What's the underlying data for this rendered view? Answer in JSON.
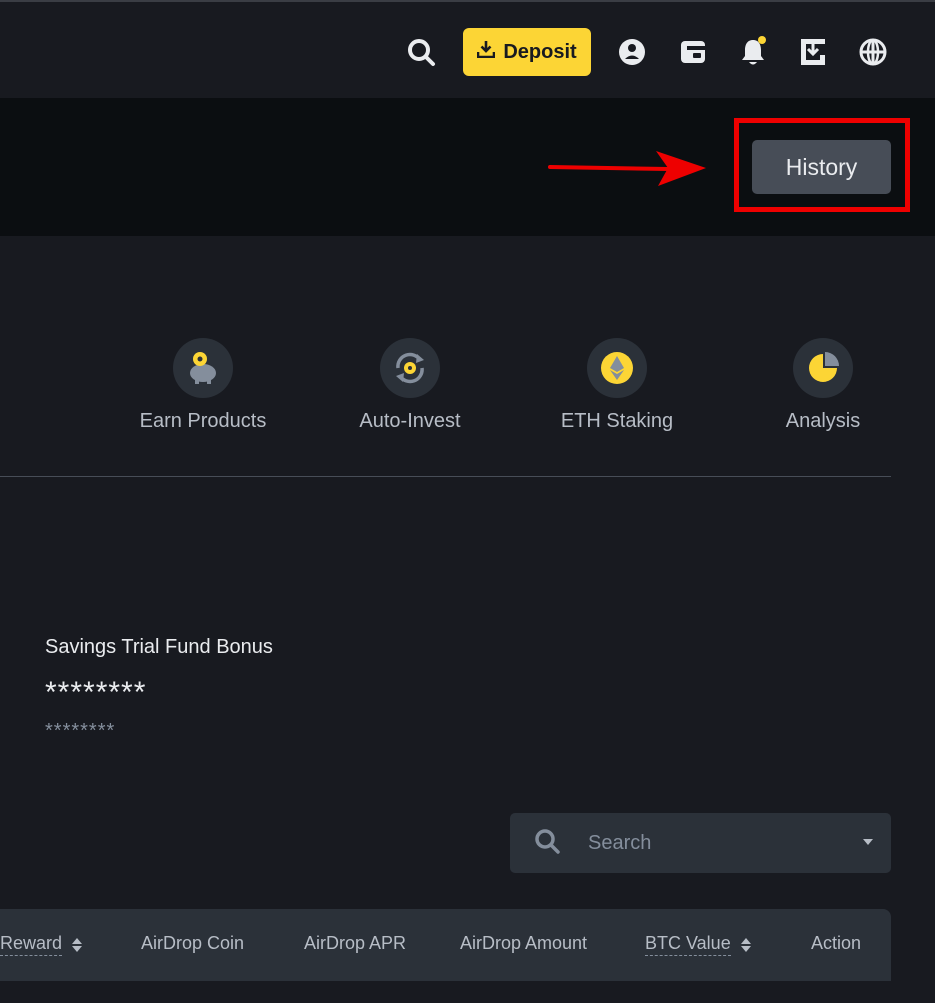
{
  "header": {
    "deposit_label": "Deposit",
    "icons": [
      "search-icon",
      "download-icon",
      "user-icon",
      "wallet-icon",
      "bell-icon",
      "app-download-icon",
      "globe-icon"
    ],
    "accent": "#fcd535"
  },
  "history": {
    "label": "History",
    "highlight_color": "#ee0000"
  },
  "nav": {
    "items": [
      {
        "label": "Earn Products",
        "icon": "piggy-bank-icon"
      },
      {
        "label": "Auto-Invest",
        "icon": "auto-invest-icon"
      },
      {
        "label": "ETH Staking",
        "icon": "ethereum-icon"
      },
      {
        "label": "Analysis",
        "icon": "pie-chart-icon"
      }
    ]
  },
  "bonus": {
    "title": "Savings Trial Fund Bonus",
    "amount": "********",
    "sub_amount": "********"
  },
  "search": {
    "placeholder": "Search"
  },
  "table": {
    "columns": [
      "Reward",
      "AirDrop Coin",
      "AirDrop APR",
      "AirDrop Amount",
      "BTC Value",
      "Action"
    ]
  }
}
